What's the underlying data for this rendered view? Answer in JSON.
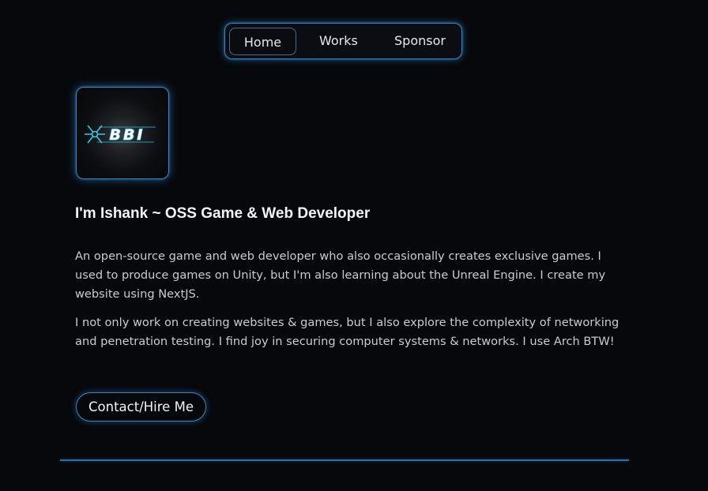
{
  "nav": {
    "items": [
      {
        "label": "Home",
        "active": true
      },
      {
        "label": "Works",
        "active": false
      },
      {
        "label": "Sponsor",
        "active": false
      }
    ]
  },
  "avatar": {
    "logo_text": "BBI"
  },
  "hero": {
    "title": "I'm Ishank ~ OSS Game & Web Developer",
    "paragraphs": [
      "An open-source game and web developer who also occasionally creates exclusive games. I used to produce games on Unity, but I'm also learning about the Unreal Engine. I create my website using NextJS.",
      "I not only work on creating websites & games, but I also explore the complexity of networking and penetration testing. I find joy in securing computer systems & networks. I use Arch BTW!"
    ],
    "cta_label": "Contact/Hire Me"
  },
  "colors": {
    "background": "#07080b",
    "accent": "#3a83c2",
    "logo_cyan": "#39d3ee"
  }
}
